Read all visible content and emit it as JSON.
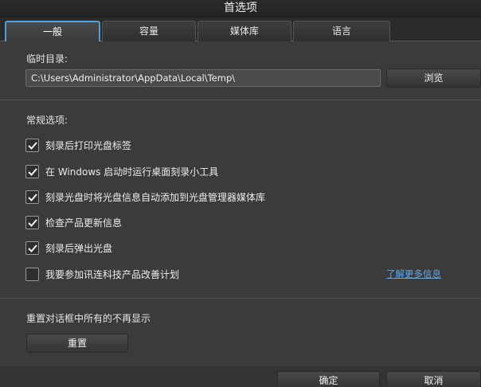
{
  "window": {
    "title": "首选项"
  },
  "tabs": [
    {
      "label": "一般",
      "active": true
    },
    {
      "label": "容量",
      "active": false
    },
    {
      "label": "媒体库",
      "active": false
    },
    {
      "label": "语言",
      "active": false
    }
  ],
  "temp_dir": {
    "label": "临时目录:",
    "value": "C:\\Users\\Administrator\\AppData\\Local\\Temp\\",
    "browse_label": "浏览"
  },
  "general": {
    "label": "常规选项:",
    "options": [
      {
        "label": "刻录后打印光盘标签",
        "checked": true
      },
      {
        "label": "在 Windows 启动时运行桌面刻录小工具",
        "checked": true
      },
      {
        "label": "刻录光盘时将光盘信息自动添加到光盘管理器媒体库",
        "checked": true
      },
      {
        "label": "检查产品更新信息",
        "checked": true
      },
      {
        "label": "刻录后弹出光盘",
        "checked": true
      },
      {
        "label": "我要参加讯连科技产品改善计划",
        "checked": false
      }
    ],
    "learn_more": "了解更多信息"
  },
  "reset": {
    "label": "重置对话框中所有的不再显示",
    "button_label": "重置"
  },
  "footer": {
    "ok_label": "确定",
    "cancel_label": "取消"
  },
  "colors": {
    "accent": "#4da0e0",
    "link": "#5fa8e8",
    "background": "#3b3b3b"
  }
}
